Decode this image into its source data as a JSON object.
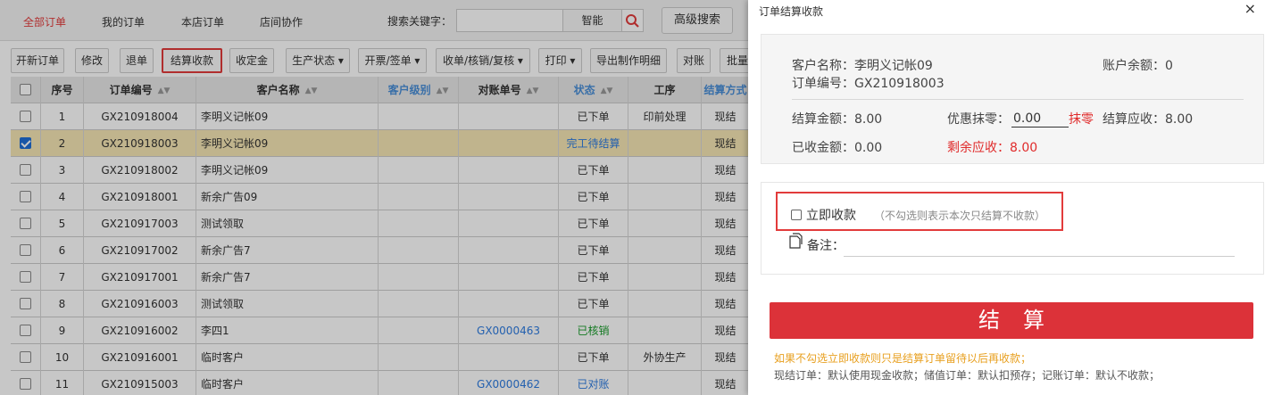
{
  "topnav": {
    "tabs": [
      "全部订单",
      "我的订单",
      "本店订单",
      "店间协作"
    ],
    "search_label": "搜索关键字：",
    "search_value": "",
    "smart_label": "智能",
    "advanced_label": "高级搜索"
  },
  "toolbar": {
    "buttons": [
      "开新订单",
      "修改",
      "退单",
      "结算收款",
      "收定金",
      "生产状态 ▾",
      "开票/签单 ▾",
      "收单/核销/复核 ▾",
      "打印 ▾",
      "导出制作明细",
      "对账",
      "批量"
    ]
  },
  "grid": {
    "headers": [
      "序号",
      "订单编号",
      "客户名称",
      "客户级别",
      "对账单号",
      "状态",
      "工序",
      "结算方式"
    ],
    "rows": [
      {
        "no": "1",
        "order": "GX210918004",
        "customer": "李明义记帐09",
        "level": "",
        "recon": "",
        "status": "已下单",
        "process": "印前处理",
        "pay": "现结",
        "checked": false
      },
      {
        "no": "2",
        "order": "GX210918003",
        "customer": "李明义记帐09",
        "level": "",
        "recon": "",
        "status": "完工待结算",
        "process": "",
        "pay": "现结",
        "checked": true
      },
      {
        "no": "3",
        "order": "GX210918002",
        "customer": "李明义记帐09",
        "level": "",
        "recon": "",
        "status": "已下单",
        "process": "",
        "pay": "现结",
        "checked": false
      },
      {
        "no": "4",
        "order": "GX210918001",
        "customer": "新余广告09",
        "level": "",
        "recon": "",
        "status": "已下单",
        "process": "",
        "pay": "现结",
        "checked": false
      },
      {
        "no": "5",
        "order": "GX210917003",
        "customer": "测试领取",
        "level": "",
        "recon": "",
        "status": "已下单",
        "process": "",
        "pay": "现结",
        "checked": false
      },
      {
        "no": "6",
        "order": "GX210917002",
        "customer": "新余广告7",
        "level": "",
        "recon": "",
        "status": "已下单",
        "process": "",
        "pay": "现结",
        "checked": false
      },
      {
        "no": "7",
        "order": "GX210917001",
        "customer": "新余广告7",
        "level": "",
        "recon": "",
        "status": "已下单",
        "process": "",
        "pay": "现结",
        "checked": false
      },
      {
        "no": "8",
        "order": "GX210916003",
        "customer": "测试领取",
        "level": "",
        "recon": "",
        "status": "已下单",
        "process": "",
        "pay": "现结",
        "checked": false
      },
      {
        "no": "9",
        "order": "GX210916002",
        "customer": "李四1",
        "level": "",
        "recon": "GX0000463",
        "status": "已核销",
        "process": "",
        "pay": "现结",
        "checked": false
      },
      {
        "no": "10",
        "order": "GX210916001",
        "customer": "临时客户",
        "level": "",
        "recon": "",
        "status": "已下单",
        "process": "外协生产",
        "pay": "现结",
        "checked": false
      },
      {
        "no": "11",
        "order": "GX210915003",
        "customer": "临时客户",
        "level": "",
        "recon": "GX0000462",
        "status": "已对账",
        "process": "",
        "pay": "现结",
        "checked": false
      }
    ]
  },
  "drawer": {
    "title": "订单结算收款",
    "close": "×",
    "customer": "客户名称：李明义记帐09",
    "balance": "账户余额：0",
    "order_no": "订单编号：GX210918003",
    "settle_amount": "结算金额：8.00",
    "discount_label": "优惠抹零：",
    "discount_value": "0.00",
    "discount_link": "抹零",
    "receivable": "结算应收：8.00",
    "received": "已收金额：0.00",
    "remaining": "剩余应收：8.00",
    "collect_label": "立即收款",
    "collect_hint": "（不勾选则表示本次只结算不收款）",
    "note_label": "备注：",
    "note_value": "",
    "settle_button": "结算",
    "tip1": "如果不勾选立即收款则只是结算订单留待以后再收款；",
    "tip2": "现结订单：默认使用现金收款；储值订单：默认扣预存；记账订单：默认不收款；"
  },
  "colors": {
    "accent_red": "#dc3239",
    "link_blue": "#2d7be0",
    "green": "#1a9d2c"
  }
}
